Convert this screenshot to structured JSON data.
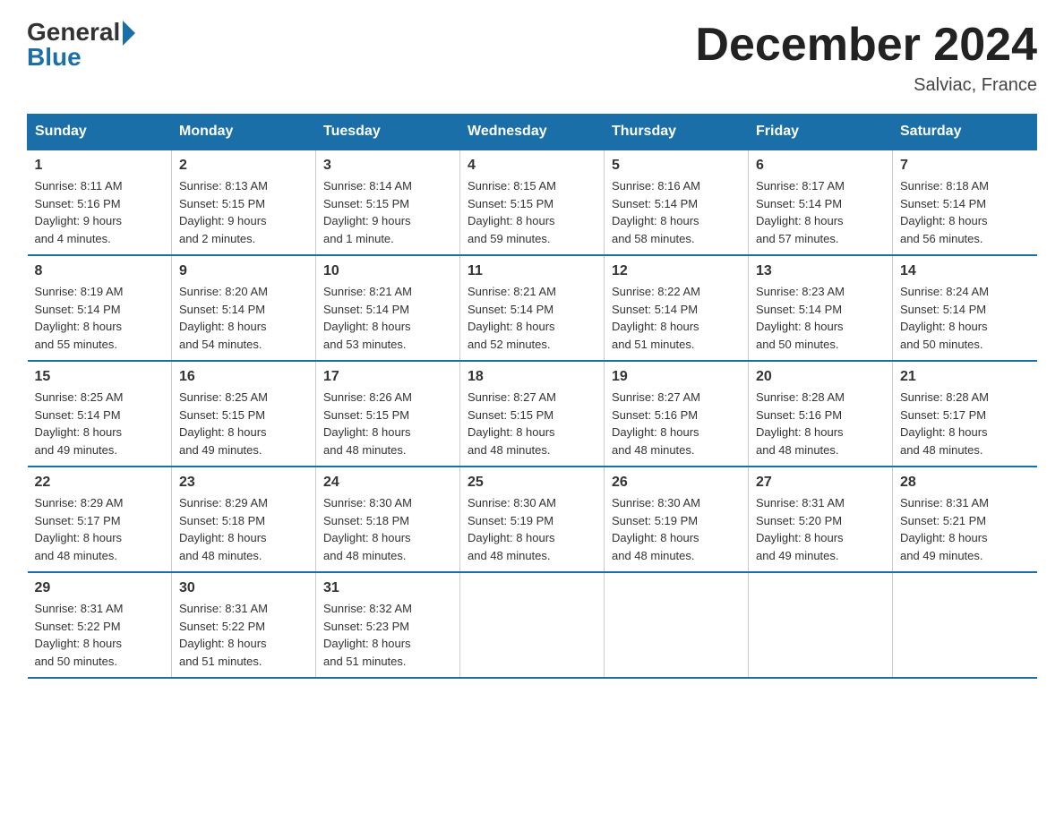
{
  "header": {
    "logo_general": "General",
    "logo_blue": "Blue",
    "month_title": "December 2024",
    "location": "Salviac, France"
  },
  "days_of_week": [
    "Sunday",
    "Monday",
    "Tuesday",
    "Wednesday",
    "Thursday",
    "Friday",
    "Saturday"
  ],
  "weeks": [
    [
      {
        "num": "1",
        "sunrise": "8:11 AM",
        "sunset": "5:16 PM",
        "daylight": "9 hours and 4 minutes."
      },
      {
        "num": "2",
        "sunrise": "8:13 AM",
        "sunset": "5:15 PM",
        "daylight": "9 hours and 2 minutes."
      },
      {
        "num": "3",
        "sunrise": "8:14 AM",
        "sunset": "5:15 PM",
        "daylight": "9 hours and 1 minute."
      },
      {
        "num": "4",
        "sunrise": "8:15 AM",
        "sunset": "5:15 PM",
        "daylight": "8 hours and 59 minutes."
      },
      {
        "num": "5",
        "sunrise": "8:16 AM",
        "sunset": "5:14 PM",
        "daylight": "8 hours and 58 minutes."
      },
      {
        "num": "6",
        "sunrise": "8:17 AM",
        "sunset": "5:14 PM",
        "daylight": "8 hours and 57 minutes."
      },
      {
        "num": "7",
        "sunrise": "8:18 AM",
        "sunset": "5:14 PM",
        "daylight": "8 hours and 56 minutes."
      }
    ],
    [
      {
        "num": "8",
        "sunrise": "8:19 AM",
        "sunset": "5:14 PM",
        "daylight": "8 hours and 55 minutes."
      },
      {
        "num": "9",
        "sunrise": "8:20 AM",
        "sunset": "5:14 PM",
        "daylight": "8 hours and 54 minutes."
      },
      {
        "num": "10",
        "sunrise": "8:21 AM",
        "sunset": "5:14 PM",
        "daylight": "8 hours and 53 minutes."
      },
      {
        "num": "11",
        "sunrise": "8:21 AM",
        "sunset": "5:14 PM",
        "daylight": "8 hours and 52 minutes."
      },
      {
        "num": "12",
        "sunrise": "8:22 AM",
        "sunset": "5:14 PM",
        "daylight": "8 hours and 51 minutes."
      },
      {
        "num": "13",
        "sunrise": "8:23 AM",
        "sunset": "5:14 PM",
        "daylight": "8 hours and 50 minutes."
      },
      {
        "num": "14",
        "sunrise": "8:24 AM",
        "sunset": "5:14 PM",
        "daylight": "8 hours and 50 minutes."
      }
    ],
    [
      {
        "num": "15",
        "sunrise": "8:25 AM",
        "sunset": "5:14 PM",
        "daylight": "8 hours and 49 minutes."
      },
      {
        "num": "16",
        "sunrise": "8:25 AM",
        "sunset": "5:15 PM",
        "daylight": "8 hours and 49 minutes."
      },
      {
        "num": "17",
        "sunrise": "8:26 AM",
        "sunset": "5:15 PM",
        "daylight": "8 hours and 48 minutes."
      },
      {
        "num": "18",
        "sunrise": "8:27 AM",
        "sunset": "5:15 PM",
        "daylight": "8 hours and 48 minutes."
      },
      {
        "num": "19",
        "sunrise": "8:27 AM",
        "sunset": "5:16 PM",
        "daylight": "8 hours and 48 minutes."
      },
      {
        "num": "20",
        "sunrise": "8:28 AM",
        "sunset": "5:16 PM",
        "daylight": "8 hours and 48 minutes."
      },
      {
        "num": "21",
        "sunrise": "8:28 AM",
        "sunset": "5:17 PM",
        "daylight": "8 hours and 48 minutes."
      }
    ],
    [
      {
        "num": "22",
        "sunrise": "8:29 AM",
        "sunset": "5:17 PM",
        "daylight": "8 hours and 48 minutes."
      },
      {
        "num": "23",
        "sunrise": "8:29 AM",
        "sunset": "5:18 PM",
        "daylight": "8 hours and 48 minutes."
      },
      {
        "num": "24",
        "sunrise": "8:30 AM",
        "sunset": "5:18 PM",
        "daylight": "8 hours and 48 minutes."
      },
      {
        "num": "25",
        "sunrise": "8:30 AM",
        "sunset": "5:19 PM",
        "daylight": "8 hours and 48 minutes."
      },
      {
        "num": "26",
        "sunrise": "8:30 AM",
        "sunset": "5:19 PM",
        "daylight": "8 hours and 48 minutes."
      },
      {
        "num": "27",
        "sunrise": "8:31 AM",
        "sunset": "5:20 PM",
        "daylight": "8 hours and 49 minutes."
      },
      {
        "num": "28",
        "sunrise": "8:31 AM",
        "sunset": "5:21 PM",
        "daylight": "8 hours and 49 minutes."
      }
    ],
    [
      {
        "num": "29",
        "sunrise": "8:31 AM",
        "sunset": "5:22 PM",
        "daylight": "8 hours and 50 minutes."
      },
      {
        "num": "30",
        "sunrise": "8:31 AM",
        "sunset": "5:22 PM",
        "daylight": "8 hours and 51 minutes."
      },
      {
        "num": "31",
        "sunrise": "8:32 AM",
        "sunset": "5:23 PM",
        "daylight": "8 hours and 51 minutes."
      },
      null,
      null,
      null,
      null
    ]
  ],
  "labels": {
    "sunrise": "Sunrise:",
    "sunset": "Sunset:",
    "daylight": "Daylight:"
  }
}
